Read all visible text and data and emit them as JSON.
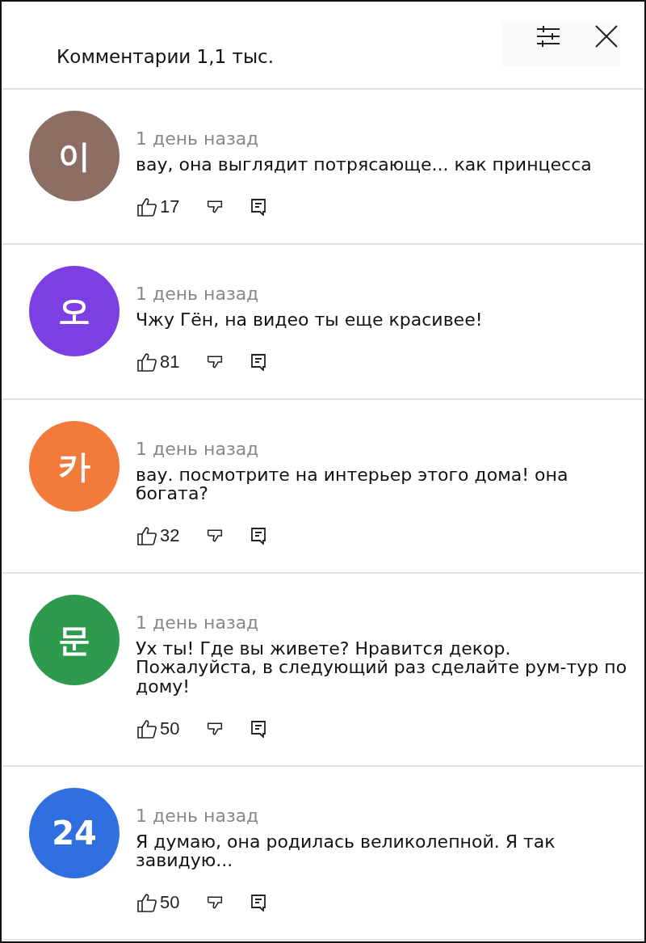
{
  "header": {
    "title": "Комментарии 1,1 тыс."
  },
  "comments": [
    {
      "avatar": "이",
      "color": "#8d6e63",
      "time": "1 день назад",
      "text": "вау, она выглядит потрясающе... как принцесса",
      "likes": "17"
    },
    {
      "avatar": "오",
      "color": "#7b3fe4",
      "time": "1 день назад",
      "text": "Чжу Гён, на видео ты еще красивее!",
      "likes": "81"
    },
    {
      "avatar": "카",
      "color": "#f27a3a",
      "time": "1 день назад",
      "text": "вау. посмотрите на интерьер этого дома! она богата?",
      "likes": "32"
    },
    {
      "avatar": "문",
      "color": "#2e9a4d",
      "time": "1 день назад",
      "text": "Ух ты! Где вы живете? Нравится декор. Пожалуйста, в следующий раз сделайте рум-тур по дому!",
      "likes": "50"
    },
    {
      "avatar": "24",
      "color": "#2f6fe0",
      "time": "1 день назад",
      "text": "Я думаю, она родилась великолепной. Я так завидую...",
      "likes": "50"
    }
  ]
}
